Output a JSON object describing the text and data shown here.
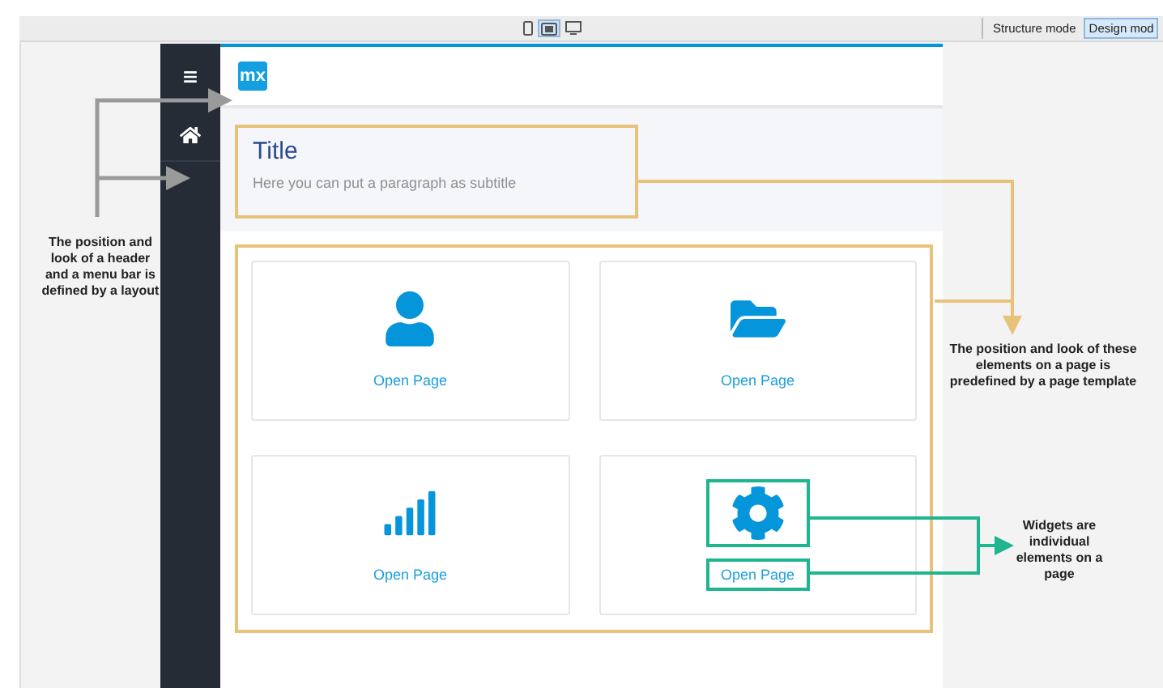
{
  "toolbar": {
    "devices": [
      {
        "kind": "phone",
        "selected": false
      },
      {
        "kind": "tablet",
        "selected": true
      },
      {
        "kind": "desktop",
        "selected": false
      }
    ],
    "modes": [
      {
        "label": "Structure mode",
        "selected": false
      },
      {
        "label": "Design mod",
        "selected": true
      }
    ]
  },
  "sidebar": {
    "items": [
      {
        "kind": "menu"
      },
      {
        "kind": "home"
      }
    ]
  },
  "header": {
    "logo": "mx"
  },
  "page_title": {
    "title": "Title",
    "subtitle": "Here you can put a paragraph as subtitle"
  },
  "tiles": [
    {
      "kind": "user",
      "link": "Open Page",
      "highlighted": false
    },
    {
      "kind": "folder",
      "link": "Open Page",
      "highlighted": false
    },
    {
      "kind": "chart",
      "link": "Open Page",
      "highlighted": false
    },
    {
      "kind": "gear",
      "link": "Open Page",
      "highlighted": true
    }
  ],
  "annotations": [
    {
      "kind": "layout",
      "text": "The position and look of a header and a menu bar is defined by a layout"
    },
    {
      "kind": "template",
      "text": "The position and look of these elements on a page is predefined by a page template"
    },
    {
      "kind": "widget",
      "text": "Widgets are individual elements on a page"
    }
  ]
}
